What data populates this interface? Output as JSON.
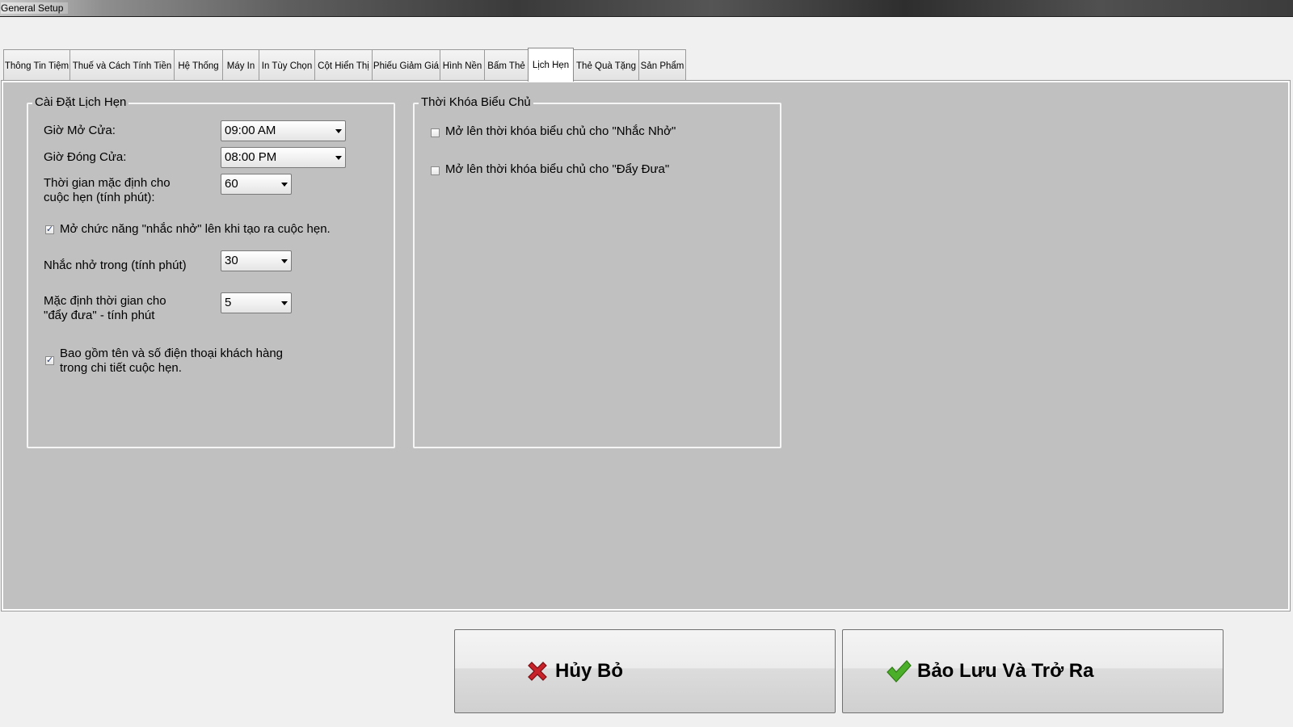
{
  "window": {
    "title": "General Setup"
  },
  "tabs": [
    {
      "label": "Thông Tin Tiệm",
      "active": false
    },
    {
      "label": "Thuế và Cách Tính Tiền",
      "active": false
    },
    {
      "label": "Hệ Thống",
      "active": false
    },
    {
      "label": "Máy In",
      "active": false
    },
    {
      "label": "In Tùy Chọn",
      "active": false
    },
    {
      "label": "Cột Hiển Thị",
      "active": false
    },
    {
      "label": "Phiếu Giảm Giá",
      "active": false
    },
    {
      "label": "Hình Nền",
      "active": false
    },
    {
      "label": "Bấm Thẻ",
      "active": false
    },
    {
      "label": "Lịch Hẹn",
      "active": true
    },
    {
      "label": "Thẻ Quà Tặng",
      "active": false
    },
    {
      "label": "Sản Phẩm",
      "active": false
    }
  ],
  "appointment_settings": {
    "legend": "Cài Đặt Lịch Hẹn",
    "open_time": {
      "label": "Giờ Mở Cửa:",
      "value": "09:00 AM"
    },
    "close_time": {
      "label": "Giờ Đóng Cửa:",
      "value": "08:00 PM"
    },
    "default_duration": {
      "label_line1": "Thời gian mặc định cho",
      "label_line2": "cuộc hẹn (tính phút):",
      "value": "60"
    },
    "enable_reminder": {
      "label": "Mở chức năng \"nhắc nhở\" lên khi tạo ra cuộc hẹn.",
      "checked": true
    },
    "reminder_minutes": {
      "label": "Nhắc nhở trong (tính phút)",
      "value": "30"
    },
    "push_default": {
      "label_line1": "Mặc định thời gian cho",
      "label_line2": "\"đẩy đưa\" - tính phút",
      "value": "5"
    },
    "include_customer_info": {
      "label_line1": "Bao gồm tên và số điện thoại khách hàng",
      "label_line2": "trong chi tiết cuộc hẹn.",
      "checked": true
    }
  },
  "owner_schedule": {
    "legend": "Thời Khóa Biểu Chủ",
    "open_for_reminder": {
      "label": "Mở lên thời khóa biểu chủ cho \"Nhắc Nhở\"",
      "checked": false
    },
    "open_for_push": {
      "label": "Mở lên thời khóa biểu chủ cho \"Đẩy Đưa\"",
      "checked": false
    }
  },
  "buttons": {
    "cancel_label": "Hủy Bỏ",
    "save_exit_label": "Bảo Lưu Và Trở Ra"
  },
  "icons": {
    "cancel": "red-x-icon",
    "save": "green-check-icon",
    "dropdown": "dropdown-arrow-icon"
  },
  "colors": {
    "panel_bg": "#c0c0c0",
    "window_bg": "#f0f0f0",
    "cancel_icon": "#c8222a",
    "save_icon": "#4caf2a"
  }
}
